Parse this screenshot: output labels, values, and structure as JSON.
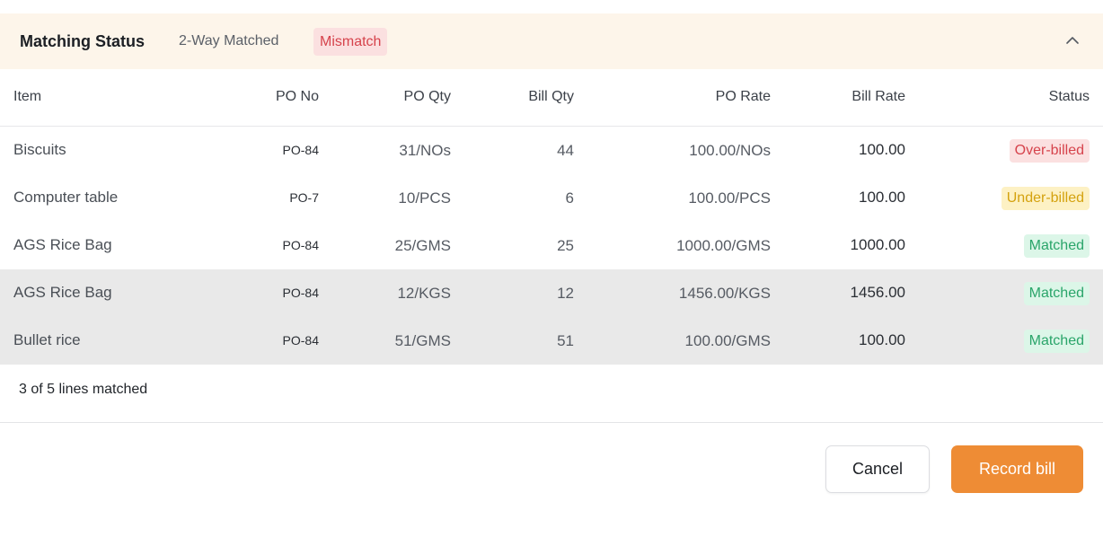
{
  "header": {
    "title": "Matching Status",
    "subtitle": "2-Way Matched",
    "mismatch_label": "Mismatch",
    "toggle_icon": "chevron-up-icon"
  },
  "table": {
    "columns": {
      "item": "Item",
      "po_no": "PO No",
      "po_qty": "PO Qty",
      "bill_qty": "Bill Qty",
      "po_rate": "PO Rate",
      "bill_rate": "Bill Rate",
      "status": "Status"
    },
    "rows": [
      {
        "item": "Biscuits",
        "po_no": "PO-84",
        "po_qty": "31/NOs",
        "bill_qty": "44",
        "po_rate": "100.00/NOs",
        "bill_rate": "100.00",
        "status": "Over-billed"
      },
      {
        "item": "Computer table",
        "po_no": "PO-7",
        "po_qty": "10/PCS",
        "bill_qty": "6",
        "po_rate": "100.00/PCS",
        "bill_rate": "100.00",
        "status": "Under-billed"
      },
      {
        "item": "AGS Rice Bag",
        "po_no": "PO-84",
        "po_qty": "25/GMS",
        "bill_qty": "25",
        "po_rate": "1000.00/GMS",
        "bill_rate": "1000.00",
        "status": "Matched"
      },
      {
        "item": "AGS Rice Bag",
        "po_no": "PO-84",
        "po_qty": "12/KGS",
        "bill_qty": "12",
        "po_rate": "1456.00/KGS",
        "bill_rate": "1456.00",
        "status": "Matched"
      },
      {
        "item": "Bullet rice",
        "po_no": "PO-84",
        "po_qty": "51/GMS",
        "bill_qty": "51",
        "po_rate": "100.00/GMS",
        "bill_rate": "100.00",
        "status": "Matched"
      }
    ]
  },
  "summary": "3 of 5 lines matched",
  "actions": {
    "cancel_label": "Cancel",
    "record_label": "Record bill"
  },
  "colors": {
    "accent": "#ee8c35",
    "header_bg": "#fdf5ea",
    "over_billed": "#d6434c",
    "under_billed": "#d4a20f",
    "matched": "#2aa56a"
  }
}
